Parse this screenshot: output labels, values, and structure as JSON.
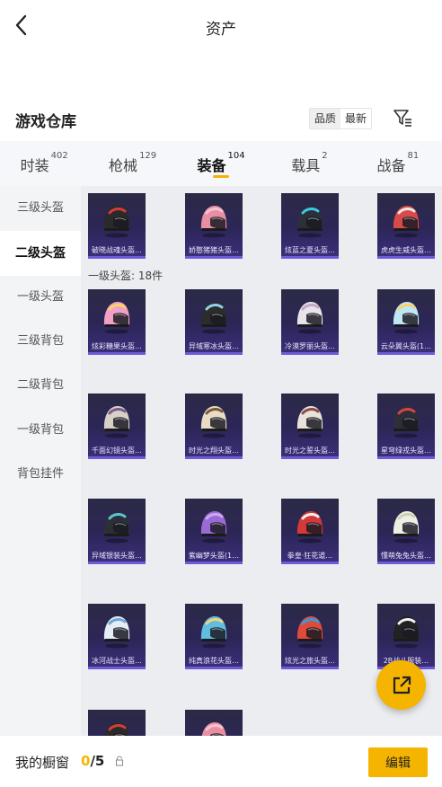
{
  "header": {
    "title": "资产",
    "back_icon": "chevron-left-icon"
  },
  "warehouse": {
    "title": "游戏仓库",
    "sort_options": [
      "品质",
      "最新"
    ],
    "sort_active": "品质",
    "filter_icon": "filter-icon"
  },
  "tabs": [
    {
      "label": "时装",
      "count": "402",
      "active": false
    },
    {
      "label": "枪械",
      "count": "129",
      "active": false
    },
    {
      "label": "装备",
      "count": "104",
      "active": true
    },
    {
      "label": "载具",
      "count": "2",
      "active": false
    },
    {
      "label": "战备",
      "count": "81",
      "active": false
    }
  ],
  "sidebar": [
    {
      "label": "三级头盔",
      "active": false
    },
    {
      "label": "二级头盔",
      "active": true
    },
    {
      "label": "一级头盔",
      "active": false
    },
    {
      "label": "三级背包",
      "active": false
    },
    {
      "label": "二级背包",
      "active": false
    },
    {
      "label": "一级背包",
      "active": false
    },
    {
      "label": "背包挂件",
      "active": false
    }
  ],
  "section_label": "一级头盔: 18件",
  "items": [
    {
      "name": "破晓战魂头盔…",
      "color": "#2a2a2a",
      "accent": "#d63b3b"
    },
    {
      "name": "娇憨猪猪头盔…",
      "color": "#e88fa4",
      "accent": "#f5c2cf"
    },
    {
      "name": "炫蓝之夏头盔…",
      "color": "#2a2f38",
      "accent": "#3fc6e8"
    },
    {
      "name": "虎虎生威头盔…",
      "color": "#d84a4a",
      "accent": "#f1e7e0"
    },
    {
      "name": "炫彩糖果头盔…",
      "color": "#f2a0c6",
      "accent": "#f7d36a"
    },
    {
      "name": "异域寒冰头盔…",
      "color": "#2c2c2c",
      "accent": "#8fd3e8"
    },
    {
      "name": "冷漠罗丽头盔…",
      "color": "#e9e3ea",
      "accent": "#c5a7c8"
    },
    {
      "name": "云朵翼头盔(1…",
      "color": "#bfe7f5",
      "accent": "#f5d36a"
    },
    {
      "name": "千面幻镜头盔…",
      "color": "#d9d0c9",
      "accent": "#7a5c8a"
    },
    {
      "name": "时光之翔头盔…",
      "color": "#e8dcc4",
      "accent": "#7a5a3a"
    },
    {
      "name": "时光之誓头盔…",
      "color": "#e9e2da",
      "accent": "#8a4b4b"
    },
    {
      "name": "星穹绿戎头盔…",
      "color": "#2e2e3a",
      "accent": "#d64545"
    },
    {
      "name": "异域银装头盔…",
      "color": "#2d2f36",
      "accent": "#5bc3d8"
    },
    {
      "name": "紫幽梦头盔(1…",
      "color": "#9a6bd6",
      "accent": "#c9a9f0"
    },
    {
      "name": "拳皇·狂花道…",
      "color": "#d23a3a",
      "accent": "#f0f0f0"
    },
    {
      "name": "懂萌兔兔头盔…",
      "color": "#eef0e6",
      "accent": "#c9d3b0"
    },
    {
      "name": "冰河战士头盔…",
      "color": "#e4ecf4",
      "accent": "#6ea6d8"
    },
    {
      "name": "纯真浪花头盔…",
      "color": "#5fbde0",
      "accent": "#f2d27a"
    },
    {
      "name": "炫光之旅头盔…",
      "color": "#e04a3a",
      "accent": "#2f9ee0"
    },
    {
      "name": "2B战斗服装…",
      "color": "#222222",
      "accent": "#f0f0f0"
    },
    {
      "name": "",
      "color": "#2a2a2a",
      "accent": "#d63b3b"
    },
    {
      "name": "",
      "color": "#e88fa4",
      "accent": "#f5c2cf"
    }
  ],
  "fab_icon": "external-link-icon",
  "bottom": {
    "label": "我的橱窗",
    "current": "0",
    "total": "/5",
    "lock_icon": "lock-icon",
    "edit_label": "编辑"
  },
  "colors": {
    "accent": "#f5b400",
    "card_bg": "#2c2657",
    "card_border": "#6f5ad9"
  }
}
